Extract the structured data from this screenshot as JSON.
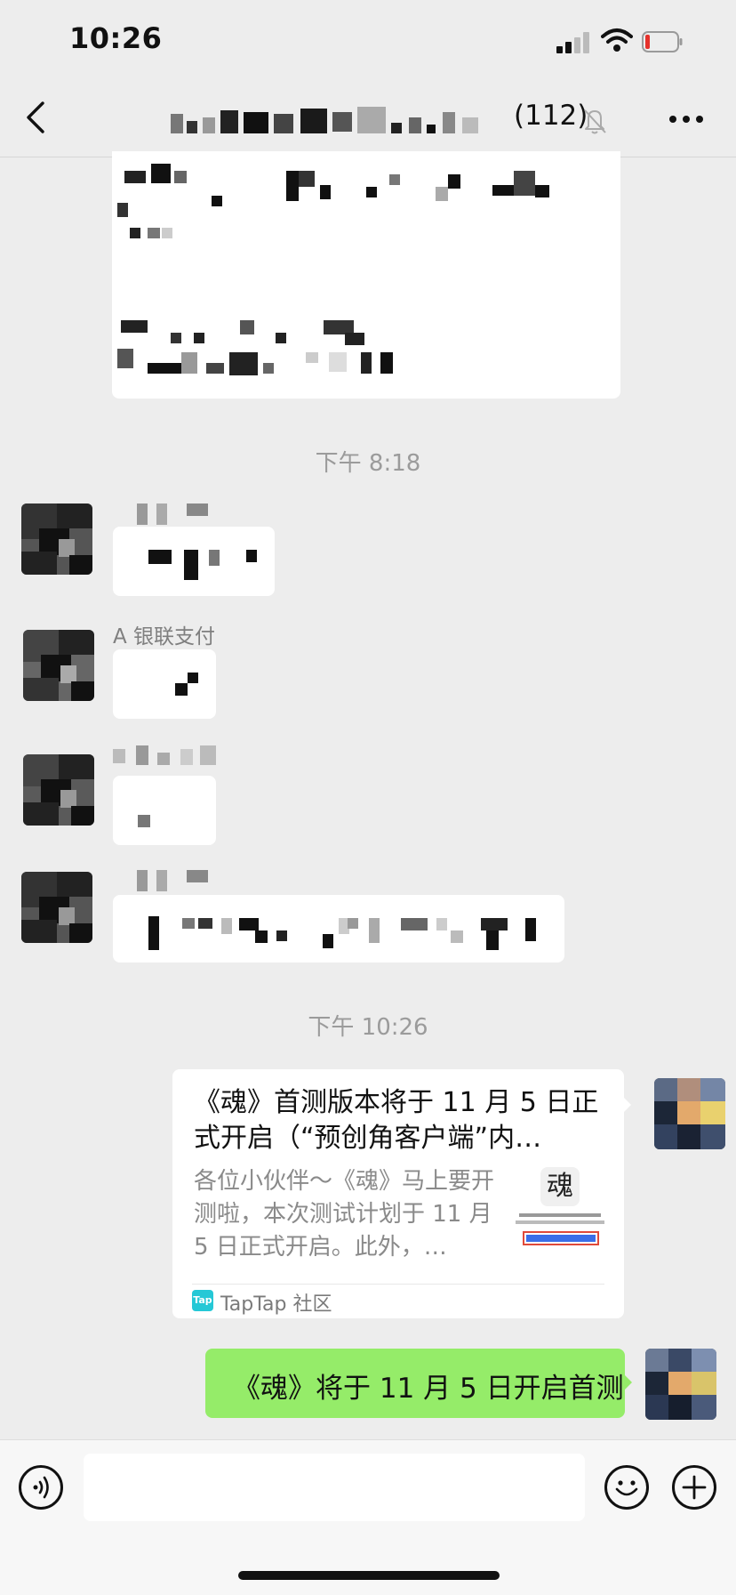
{
  "status_bar": {
    "time": "10:26",
    "battery_level": 0.1
  },
  "nav": {
    "member_count": "(112)",
    "icons": [
      "back-icon",
      "bell-slash-icon",
      "more-icon"
    ]
  },
  "messages": {
    "timestamp_1": "下午 8:18",
    "sender_label_2": "A 银联支付",
    "timestamp_2": "下午 10:26"
  },
  "link_card": {
    "title": "《魂》首测版本将于 11 月 5 日正式开启（“预创角客户端”内…",
    "description": "各位小伙伴～《魂》马上要开测啦，本次测试计划于 11 月 5 日正式开启。此外，…",
    "source": "TapTap 社区",
    "source_icon_text": "Tap",
    "thumb_char": "魂"
  },
  "outgoing_text": "《魂》将于 11 月 5 日开启首测",
  "input_bar": {
    "icons": [
      "voice-icon",
      "emoji-icon",
      "plus-icon"
    ]
  },
  "colors": {
    "background": "#ededed",
    "green_bubble": "#95ec69",
    "accent_tap": "#25c8d6"
  }
}
